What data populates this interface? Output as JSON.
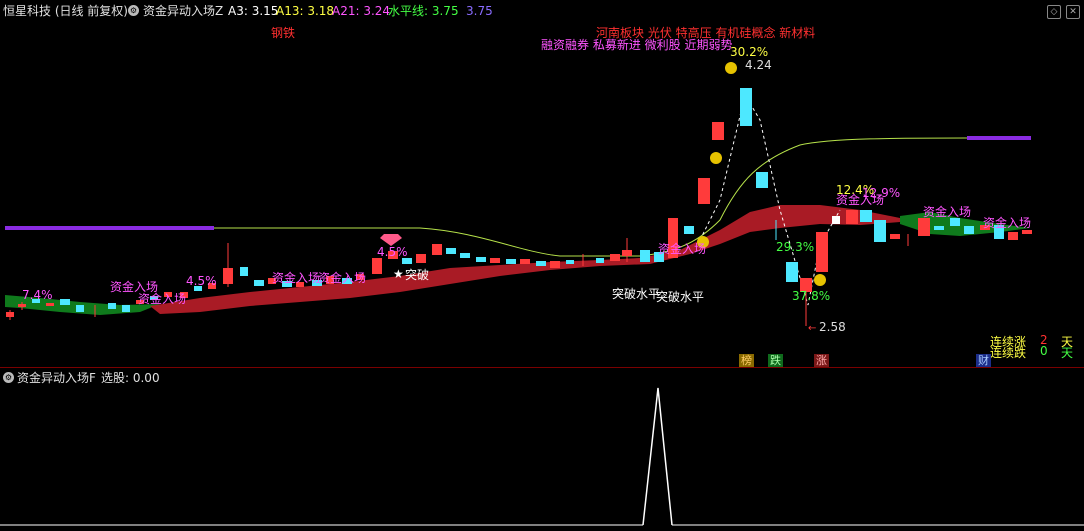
{
  "header": {
    "title": "恒星科技 (日线 前复权)",
    "indicator_name": "资金异动入场Z",
    "a3_label": "A3: 3.15",
    "a13_label": "A13: 3.18",
    "a21_label": "A21: 3.24",
    "level_label": "水平线: 3.75",
    "level_value": "3.75"
  },
  "annotations": {
    "concepts_1": "河南板块 光伏 特高压 有机硅概念 新材料",
    "concepts_2": "融资融券 私募新进 微利股 近期弱势",
    "tag_steel": "钢铁",
    "pct_302": "30.2%",
    "price_424": "4.24",
    "price_258": "2.58",
    "pct_748": "7.4%",
    "pct_45": "4.5%",
    "pct_45b": "4.5%",
    "pct_293": "29.3%",
    "pct_378": "37.8%",
    "pct_124": "12.4%",
    "pct_129": "12.9%",
    "breakout": "突破",
    "breakout_level_1": "突破水平",
    "breakout_level_2": "突破水平",
    "fund_entry_1": "资金入场",
    "fund_entry_2": "资金入场",
    "fund_entry_3": "资金入场",
    "fund_entry_4": "资金入场",
    "fund_entry_5": "资金入场",
    "fund_entry_6": "资金入场",
    "fund_entry_7": "资金入场",
    "fund_entry_8": "资金入场"
  },
  "stats": {
    "up_label": "连续涨",
    "up_count": "2",
    "up_unit": "天",
    "down_label": "连续跌",
    "down_count": "0",
    "down_unit": "天"
  },
  "markers": {
    "m1": "榜",
    "m2": "跌",
    "m3": "涨",
    "m4": "财"
  },
  "sub_panel": {
    "title": "资金异动入场F",
    "select_label": "选股: 0.00"
  },
  "colors": {
    "up": "#ff3b3b",
    "down": "#4de8ff",
    "band": "#b01e28",
    "band_green": "#0f7a1c",
    "level_line": "#8a2be2",
    "ma_line": "#c8e860"
  }
}
